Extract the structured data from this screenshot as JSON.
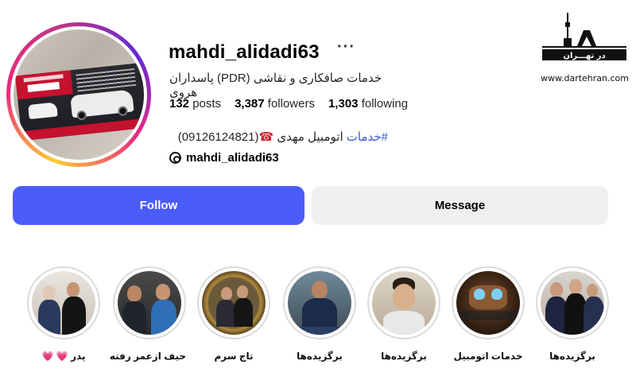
{
  "profile": {
    "username": "mahdi_alidadi63",
    "more_label": "···",
    "bio_name": "خدمات صافکاری و نقاشی (PDR) پاسداران هروی",
    "stats": {
      "posts_count": "132",
      "posts_label": "posts",
      "followers_count": "3,387",
      "followers_label": "followers",
      "following_count": "1,303",
      "following_label": "following"
    },
    "bio_tag": "#خدمات",
    "bio_text": " اتومبیل مهدی ",
    "bio_phone_icon": "☎",
    "bio_phone": "(09126124821)",
    "threads_handle": "mahdi_alidadi63"
  },
  "avatar_card": {
    "title": "خدمات اتومبیل",
    "name": "مهدی"
  },
  "logo": {
    "text": "در تهـــران",
    "url": "www.dartehran.com"
  },
  "actions": {
    "follow_label": "Follow",
    "message_label": "Message"
  },
  "highlights": [
    {
      "label": "برگزیده‌ها"
    },
    {
      "label": "خدمات اتومبیل"
    },
    {
      "label": "برگزیده‌ها"
    },
    {
      "label": "برگزیده‌ها"
    },
    {
      "label": "تاج سرم"
    },
    {
      "label": "حیف ازعمر رفته"
    },
    {
      "label": "پدر 💗 💗"
    }
  ],
  "colors": {
    "follow_bg": "#4a5df9",
    "message_bg": "#efeff2",
    "tag_link": "#3a57d6"
  }
}
